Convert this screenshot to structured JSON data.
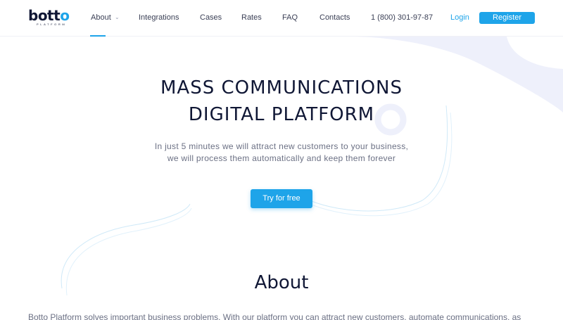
{
  "brand": {
    "logo_main": "bott",
    "logo_accent": "o",
    "logo_sub": "PLATFORM"
  },
  "nav": {
    "items": [
      {
        "label": "About",
        "has_dropdown": true,
        "active": true
      },
      {
        "label": "Integrations"
      },
      {
        "label": "Cases"
      },
      {
        "label": "Rates"
      },
      {
        "label": "FAQ"
      },
      {
        "label": "Contacts"
      }
    ],
    "phone": "1 (800) 301-97-87",
    "login_label": "Login",
    "register_label": "Register"
  },
  "hero": {
    "title_line1": "MASS COMMUNICATIONS",
    "title_line2": "DIGITAL PLATFORM",
    "subtitle_line1": "In just 5 minutes we will attract new customers to your business,",
    "subtitle_line2": "we will process them automatically and keep them forever",
    "cta_label": "Try for free"
  },
  "about": {
    "heading": "About",
    "text": "Botto Platform solves important business problems. With our platform you can attract new customers, automate communications, as"
  },
  "colors": {
    "accent": "#1ea4e9",
    "heading": "#101735",
    "muted": "#6b7084",
    "decor": "#eef0fb"
  }
}
